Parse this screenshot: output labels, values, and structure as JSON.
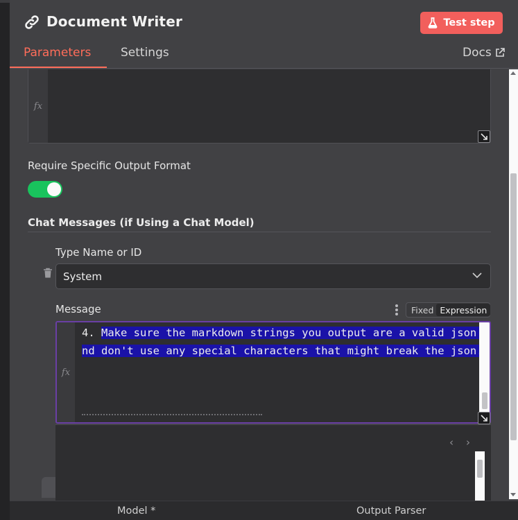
{
  "header": {
    "title": "Document Writer",
    "test_step_label": "Test step",
    "tabs": [
      {
        "label": "Parameters",
        "active": true
      },
      {
        "label": "Settings",
        "active": false
      }
    ],
    "docs_label": "Docs"
  },
  "top_expression": {
    "fx_label": "fx"
  },
  "output_format": {
    "label": "Require Specific Output Format",
    "enabled": true
  },
  "chat_messages": {
    "section_title": "Chat Messages (if Using a Chat Model)",
    "type_label": "Type Name or ID",
    "type_value": "System",
    "message_label": "Message",
    "mode_options": [
      "Fixed",
      "Expression"
    ],
    "mode_selected": "Expression",
    "fx_label": "fx",
    "code_prefix": "4. ",
    "code_line1_selected": "Make sure the markdown strings you output are a valid json a",
    "code_line2_selected": "nd don't use any special characters that might break the json."
  },
  "bottom_bar": {
    "model_label": "Model *",
    "output_parser_label": "Output Parser"
  },
  "colors": {
    "accent": "#ff6d5a",
    "test_button": "#f25f5c",
    "toggle_on": "#19c35d",
    "selection": "#1a12a8",
    "expression_border": "#6a3fa5"
  }
}
